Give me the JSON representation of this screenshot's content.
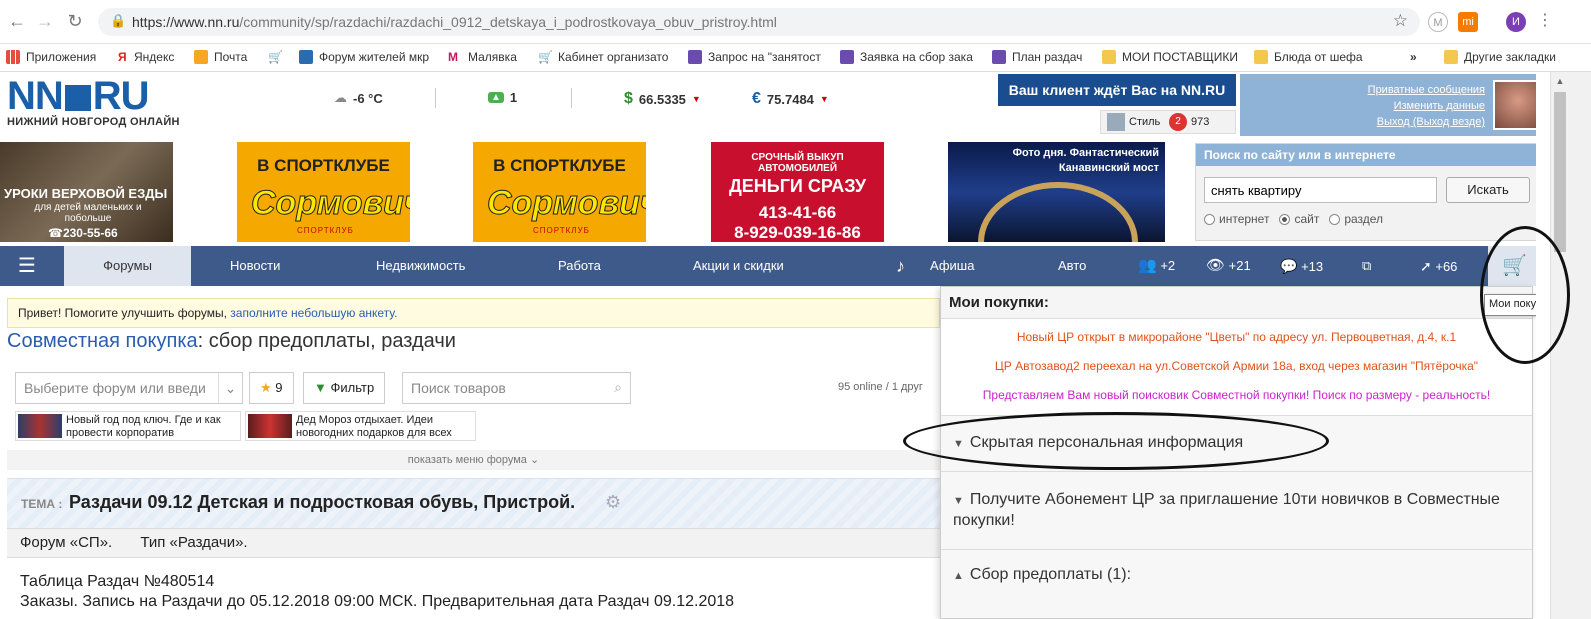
{
  "browser": {
    "url_host": "https://www.nn.ru",
    "url_path": "/community/sp/razdachi/razdachi_0912_detskaya_i_podrostkovaya_obuv_pristroy.html",
    "profile_initial": "И",
    "bookmarks": [
      {
        "label": "Приложения",
        "color": "#e84c3d"
      },
      {
        "label": "Яндекс",
        "color": "#e2231a"
      },
      {
        "label": "Почта",
        "color": "#f5a623"
      },
      {
        "label": "Форум жителей мкр",
        "color": "#2b6cb0"
      },
      {
        "label": "Малявка",
        "color": "#c2185b"
      },
      {
        "label": "Кабинет организато",
        "color": "#333333"
      },
      {
        "label": "Запрос на \"занятост",
        "color": "#6a4caf"
      },
      {
        "label": "Заявка на сбор зака",
        "color": "#6a4caf"
      },
      {
        "label": "План раздач",
        "color": "#6a4caf"
      },
      {
        "label": "МОИ ПОСТАВЩИКИ",
        "color": "#f2c94c"
      },
      {
        "label": "Блюда от шефа",
        "color": "#f2c94c"
      },
      {
        "label": "»",
        "color": ""
      },
      {
        "label": "Другие закладки",
        "color": "#f2c94c"
      }
    ]
  },
  "header": {
    "logo_left": "NN",
    "logo_right": "RU",
    "logo_sub": "НИЖНИЙ НОВГОРОД ОНЛАЙН",
    "weather": "-6 °C",
    "traffic": "1",
    "usd": "66.5335",
    "eur": "75.7484",
    "promo": "Ваш клиент ждёт Вас на NN.RU",
    "promo_sub": "Стиль",
    "promo_count": "973",
    "user_links": [
      "Приватные сообщения",
      "Изменить данные",
      "Выход (Выход везде)"
    ]
  },
  "banners": {
    "horse_title": "УРОКИ ВЕРХОВОЙ ЕЗДЫ",
    "horse_sub": "для детей маленьких и побольше",
    "horse_phone": "230-55-66",
    "sport_title": "В СПОРТКЛУБЕ",
    "sport_brand": "Сормович",
    "sport_sub": "СПОРТКЛУБ",
    "auto_l1": "СРОЧНЫЙ ВЫКУП АВТОМОБИЛЕЙ",
    "auto_l2": "ДЕНЬГИ СРАЗУ",
    "auto_l3": "413-41-66",
    "auto_l4": "8-929-039-16-86",
    "photo_caption": "Фото дня. Фантастический Канавинский мост"
  },
  "site_search": {
    "title": "Поиск по сайту или в интернете",
    "value": "снять квартиру",
    "button": "Искать",
    "options": [
      "интернет",
      "сайт",
      "раздел"
    ]
  },
  "nav": {
    "active": "Форумы",
    "items": [
      "Новости",
      "Недвижимость",
      "Работа",
      "Акции и скидки",
      "Афиша",
      "Авто"
    ],
    "counters": [
      "+2",
      "+21",
      "+13",
      "",
      "+66"
    ]
  },
  "main": {
    "notice_text": "Привет! Помогите улучшить форумы,",
    "notice_link": "заполните небольшую анкету.",
    "title_link": "Совместная покупка",
    "title_rest": ": сбор предоплаты, раздачи",
    "forum_select": "Выберите форум или введи",
    "fav_count": "9",
    "filter": "Фильтр",
    "search_placeholder": "Поиск товаров",
    "online": "95 online / 1 друг",
    "mini1": "Новый год под ключ. Где и как провести корпоратив",
    "mini2": "Дед Мороз отдыхает. Идеи новогодних подарков для всех",
    "show_menu": "показать меню форума",
    "theme_label": "ТЕМА :",
    "theme_title": "Раздачи 09.12 Детская и подростковая обувь, Пристрой.",
    "crumb_forum": "Форум «СП».",
    "crumb_type": "Тип «Раздачи».",
    "post_l1": "Таблица Раздач №480514",
    "post_l2": "Заказы. Запись на Раздачи до 05.12.2018 09:00 МСК. Предварительная дата Раздач 09.12.2018"
  },
  "purchases": {
    "title": "Мои покупки:",
    "tooltip": "Мои покупки",
    "ann1": "Новый ЦР открыт в микрорайоне \"Цветы\" по адресу ул. Первоцветная, д.4, к.1",
    "ann2": "ЦР Автозавод2 переехал на ул.Советской Армии 18а, вход через магазин \"Пятёрочка\"",
    "ann3": "Представляем Вам новый поисковик Совместной покупки! Поиск по размеру - реальность!",
    "acc1": "Скрытая персональная информация",
    "acc2": "Получите Абонемент ЦР за приглашение 10ти новичков в Совместные покупки!",
    "acc3": "Сбор предоплаты (1):",
    "colors": {
      "ann1": "#e0521b",
      "ann2": "#e0521b",
      "ann3": "#cc22cc"
    }
  }
}
